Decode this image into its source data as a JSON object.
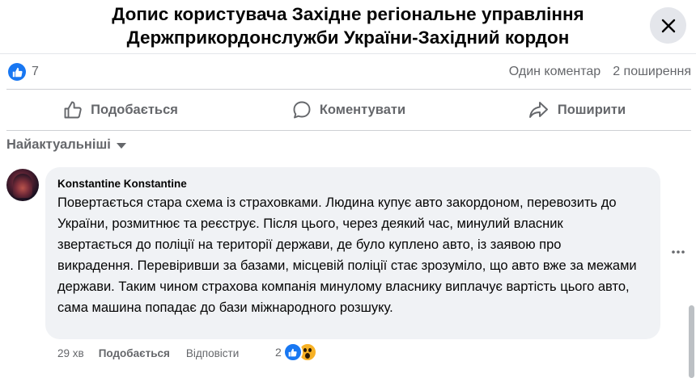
{
  "header": {
    "title_line1": "Допис користувача Західне регіональне управління",
    "title_line2": "Держприкордонслужби України-Західний кордон"
  },
  "stats": {
    "like_count": "7",
    "comments": "Один коментар",
    "shares": "2 поширення"
  },
  "actions": {
    "like": "Подобається",
    "comment": "Коментувати",
    "share": "Поширити"
  },
  "sort": {
    "label": "Найактуальніші"
  },
  "comment": {
    "author": "Konstantine Konstantine",
    "text": "Повертається стара схема із страховками. Людина купує авто закордоном, перевозить до України, розмитнює та реєструє. Після цього, через деякий час, минулий власник звертається до поліції на території держави, де було куплено авто, із заявою про викрадення. Перевіривши за базами, місцевій поліції стає зрозуміло, що авто вже за межами держави. Таким чином страхова компанія минулому власнику виплачує вартість цього авто, сама машина попадає до бази міжнародного розшуку.",
    "time": "29 хв",
    "like_label": "Подобається",
    "reply_label": "Відповісти",
    "reaction_count": "2",
    "reactions": [
      "like-icon",
      "wow-icon"
    ]
  },
  "colors": {
    "accent": "#1877f2",
    "secondary_text": "#65676b",
    "bubble": "#f0f2f5"
  }
}
